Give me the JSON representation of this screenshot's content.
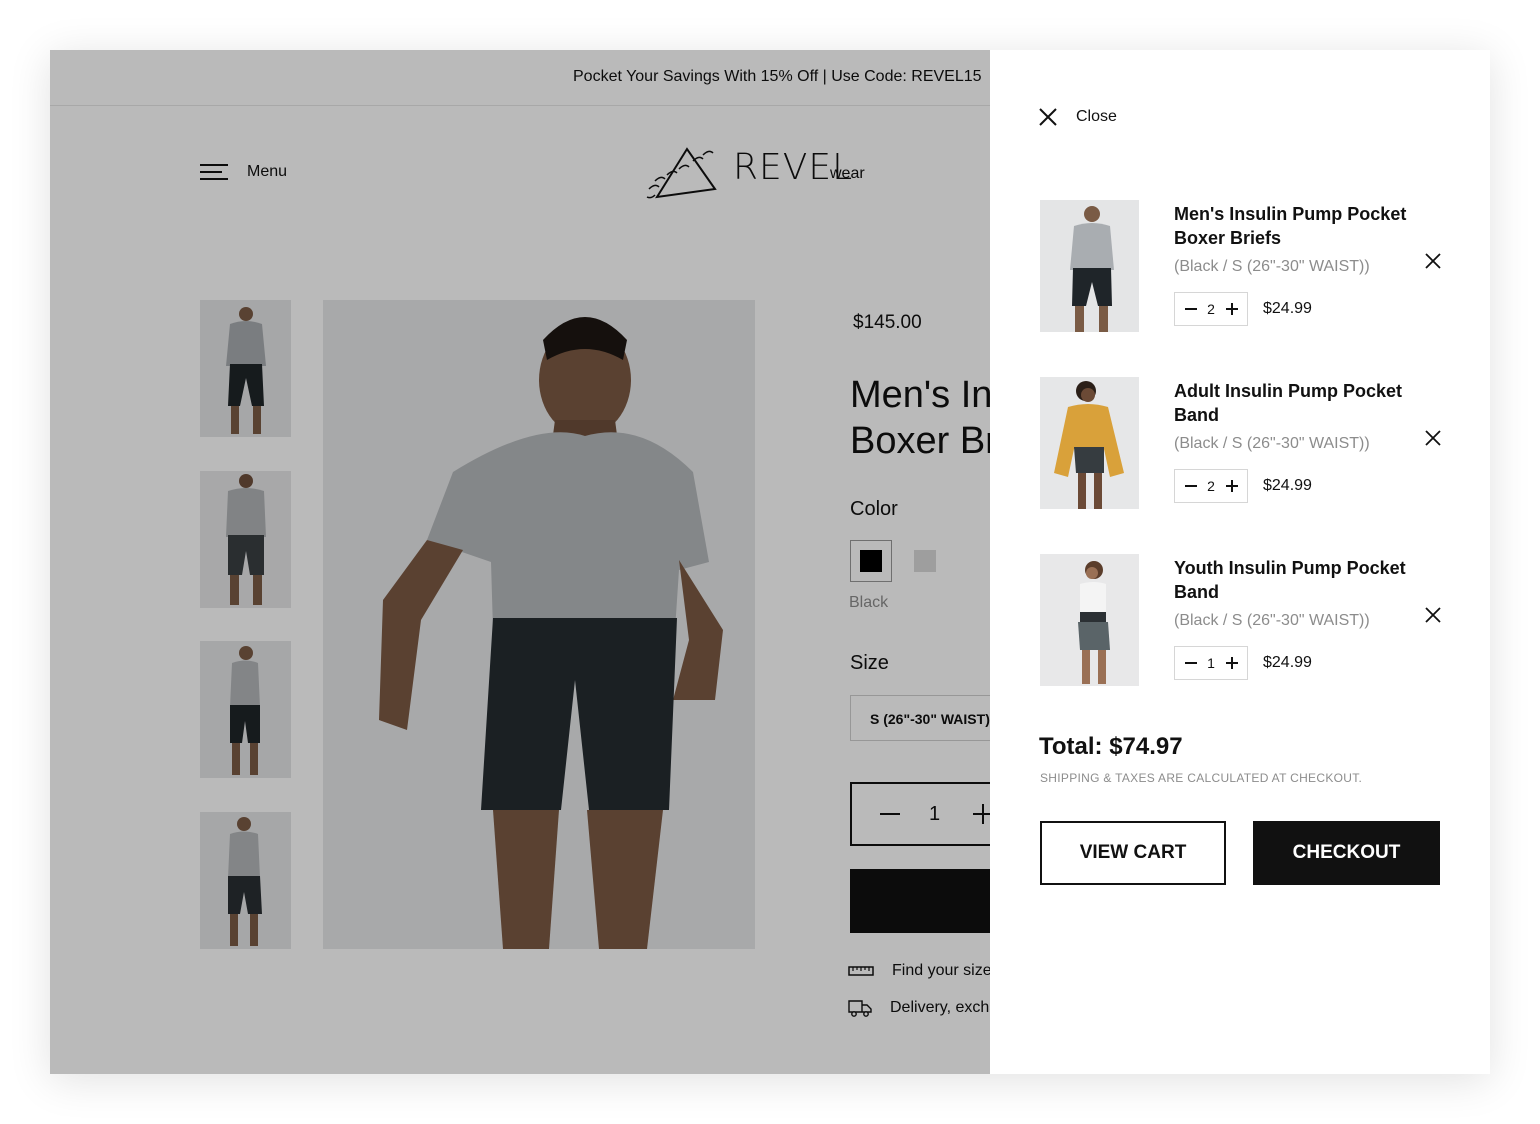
{
  "announcement": "Pocket Your Savings With 15% Off | Use Code: REVEL15",
  "header": {
    "menu_label": "Menu",
    "logo_word": "REVEL",
    "logo_sub": "wear"
  },
  "product": {
    "price": "$145.00",
    "title_line1": "Men's Insulin Pump Pocket",
    "title_line2": "Boxer Briefs",
    "color_label": "Color",
    "color_value": "Black",
    "size_label": "Size",
    "size_value": "S (26\"-30\" WAIST)",
    "quantity": "1",
    "find_size": "Find your size",
    "delivery": "Delivery, exchanges & returns"
  },
  "drawer": {
    "close_label": "Close",
    "items": [
      {
        "name": "Men's Insulin Pump Pocket Boxer Briefs",
        "variant": "(Black / S (26\"-30\" WAIST))",
        "qty": "2",
        "price": "$24.99"
      },
      {
        "name": "Adult Insulin Pump Pocket Band",
        "variant": "(Black / S (26\"-30\" WAIST))",
        "qty": "2",
        "price": "$24.99"
      },
      {
        "name": "Youth Insulin Pump Pocket Band",
        "variant": "(Black / S (26\"-30\" WAIST))",
        "qty": "1",
        "price": "$24.99"
      }
    ],
    "total": "Total: $74.97",
    "shipping_note": "SHIPPING & TAXES ARE CALCULATED AT CHECKOUT.",
    "view_cart_label": "VIEW CART",
    "checkout_label": "CHECKOUT"
  },
  "colors": {
    "accent": "#111111",
    "overlay": "rgba(0,0,0,0.27)",
    "muted_text": "#8c8c8c"
  },
  "icons": [
    "menu-icon",
    "logo-mountain-icon",
    "close-icon",
    "remove-icon",
    "ruler-icon",
    "truck-icon",
    "minus-icon",
    "plus-icon"
  ]
}
